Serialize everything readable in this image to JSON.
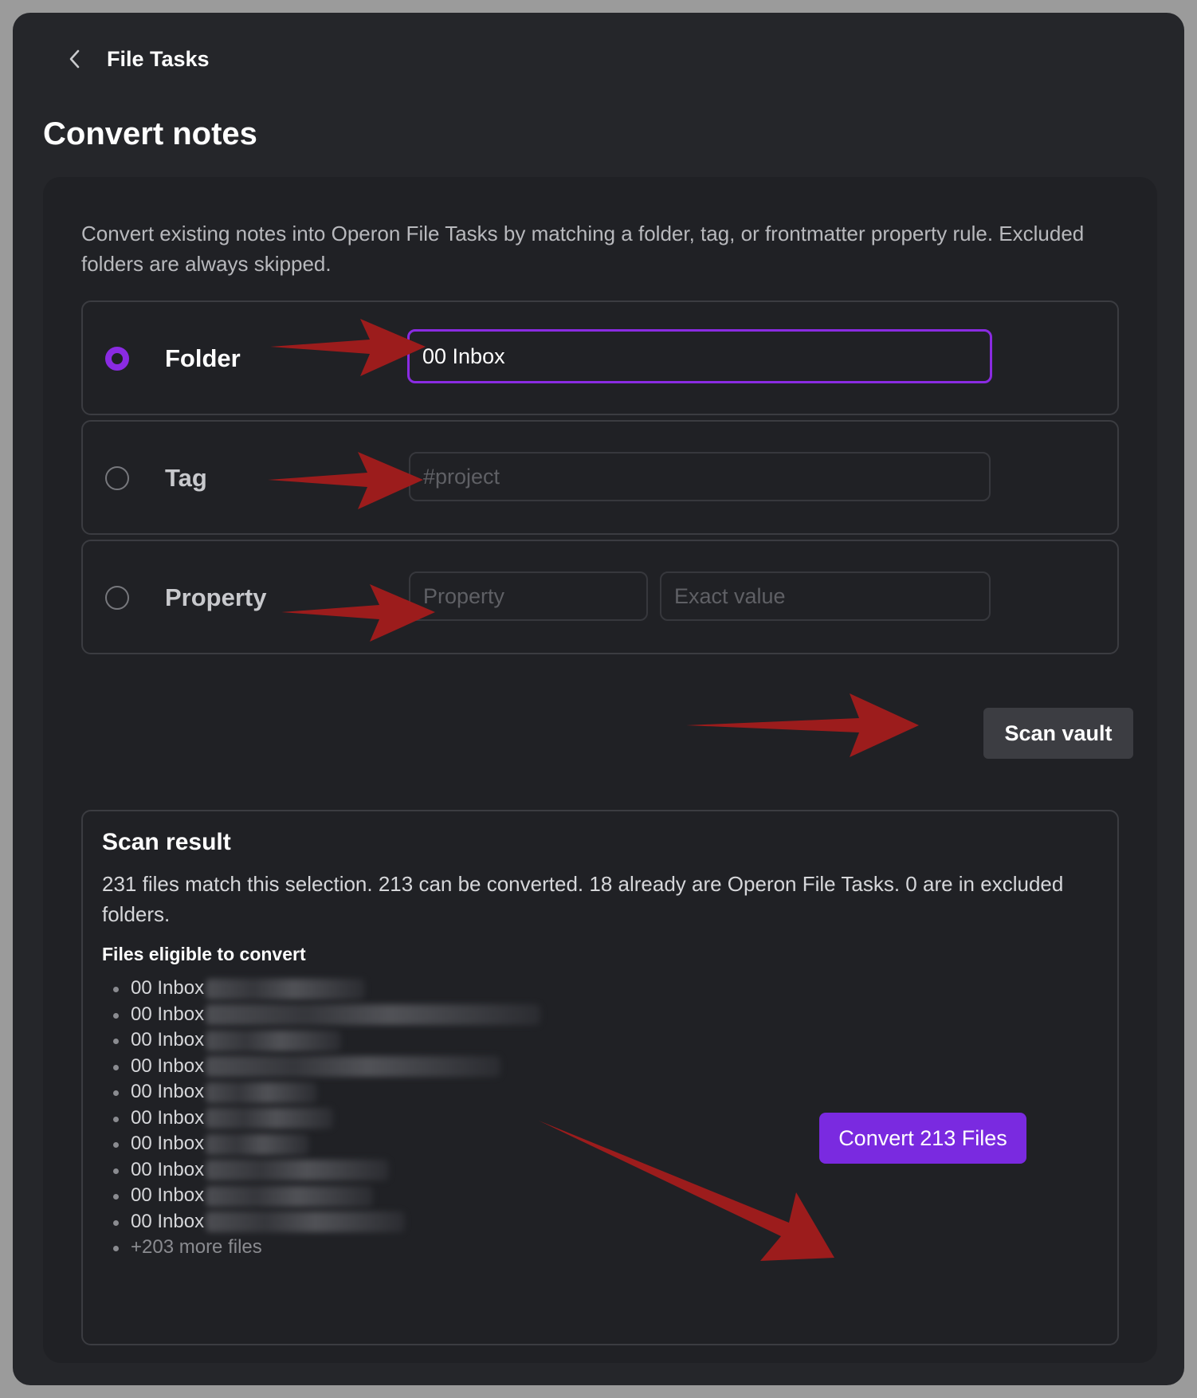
{
  "header": {
    "title": "File Tasks",
    "back_icon": "chevron-left-icon"
  },
  "page": {
    "title": "Convert notes",
    "description": "Convert existing notes into Operon File Tasks by matching a folder, tag, or frontmatter property rule. Excluded folders are always skipped."
  },
  "rules": {
    "folder": {
      "label": "Folder",
      "value": "00 Inbox",
      "selected": true
    },
    "tag": {
      "label": "Tag",
      "placeholder": "#project",
      "selected": false
    },
    "property": {
      "label": "Property",
      "name_placeholder": "Property",
      "value_placeholder": "Exact value",
      "selected": false
    }
  },
  "scan_button": "Scan vault",
  "result": {
    "title": "Scan result",
    "summary": "231 files match this selection. 213 can be converted. 18 already are Operon File Tasks. 0 are in excluded folders.",
    "eligible_title": "Files eligible to convert",
    "files": [
      "00 Inbox",
      "00 Inbox",
      "00 Inbox",
      "00 Inbox",
      "00 Inbox",
      "00 Inbox",
      "00 Inbox",
      "00 Inbox",
      "00 Inbox",
      "00 Inbox"
    ],
    "more": "+203 more files"
  },
  "convert_button": "Convert 213 Files",
  "colors": {
    "accent": "#8a2be2",
    "annotation": "#9c1c1c",
    "background": "#25262a"
  }
}
